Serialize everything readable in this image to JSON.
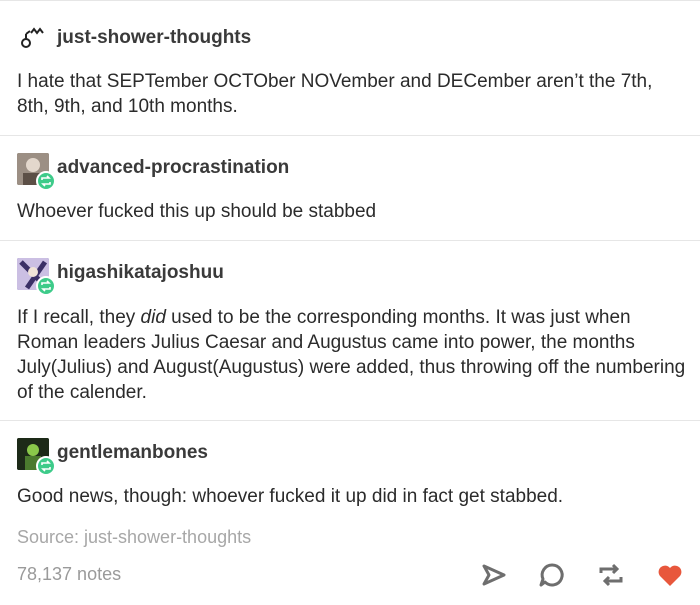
{
  "posts": [
    {
      "username": "just-shower-thoughts",
      "text": "I hate that SEPTember OCTOber NOVember and DECember aren’t the 7th, 8th, 9th, and 10th months."
    },
    {
      "username": "advanced-procrastination",
      "text": "Whoever fucked this up should be stabbed"
    },
    {
      "username": "higashikatajoshuu",
      "text_before": "If I recall, they ",
      "text_em": "did",
      "text_after": " used to be the corresponding months. It was just when Roman leaders Julius Caesar and Augustus came into power, the months July(Julius) and August(Augustus) were added, thus throwing off the numbering of the calender."
    },
    {
      "username": "gentlemanbones",
      "text": "Good news, though: whoever fucked it up did in fact get stabbed."
    }
  ],
  "source_text": "Source: just-shower-thoughts",
  "notes_text": "78,137 notes",
  "icons": {
    "share": "share-icon",
    "reply": "reply-icon",
    "reblog": "reblog-icon",
    "like": "heart-icon"
  },
  "colors": {
    "reblog_badge": "#3ecb8a",
    "heart": "#e8573c",
    "action_icon": "#6e6e6e"
  }
}
